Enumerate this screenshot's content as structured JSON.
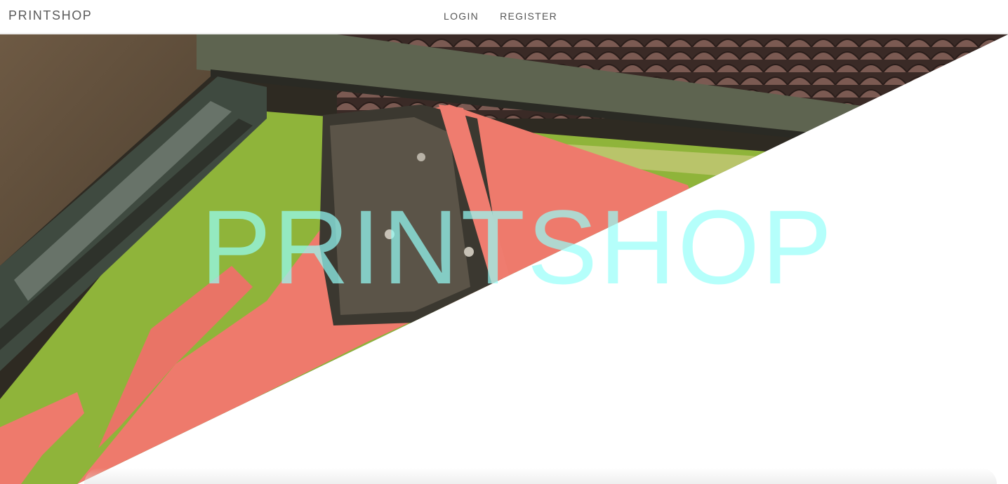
{
  "navbar": {
    "brand": "PRINTSHOP",
    "links": [
      {
        "label": "LOGIN"
      },
      {
        "label": "REGISTER"
      }
    ]
  },
  "hero": {
    "title": "PRINTSHOP",
    "photo_subject": "screen printing press with squeegee and pink ink on green screen"
  },
  "colors": {
    "title_cyan": "#96fffa",
    "nav_text": "#555555",
    "ink_pink": "#ee7a6c",
    "screen_green": "#8fb43a"
  }
}
